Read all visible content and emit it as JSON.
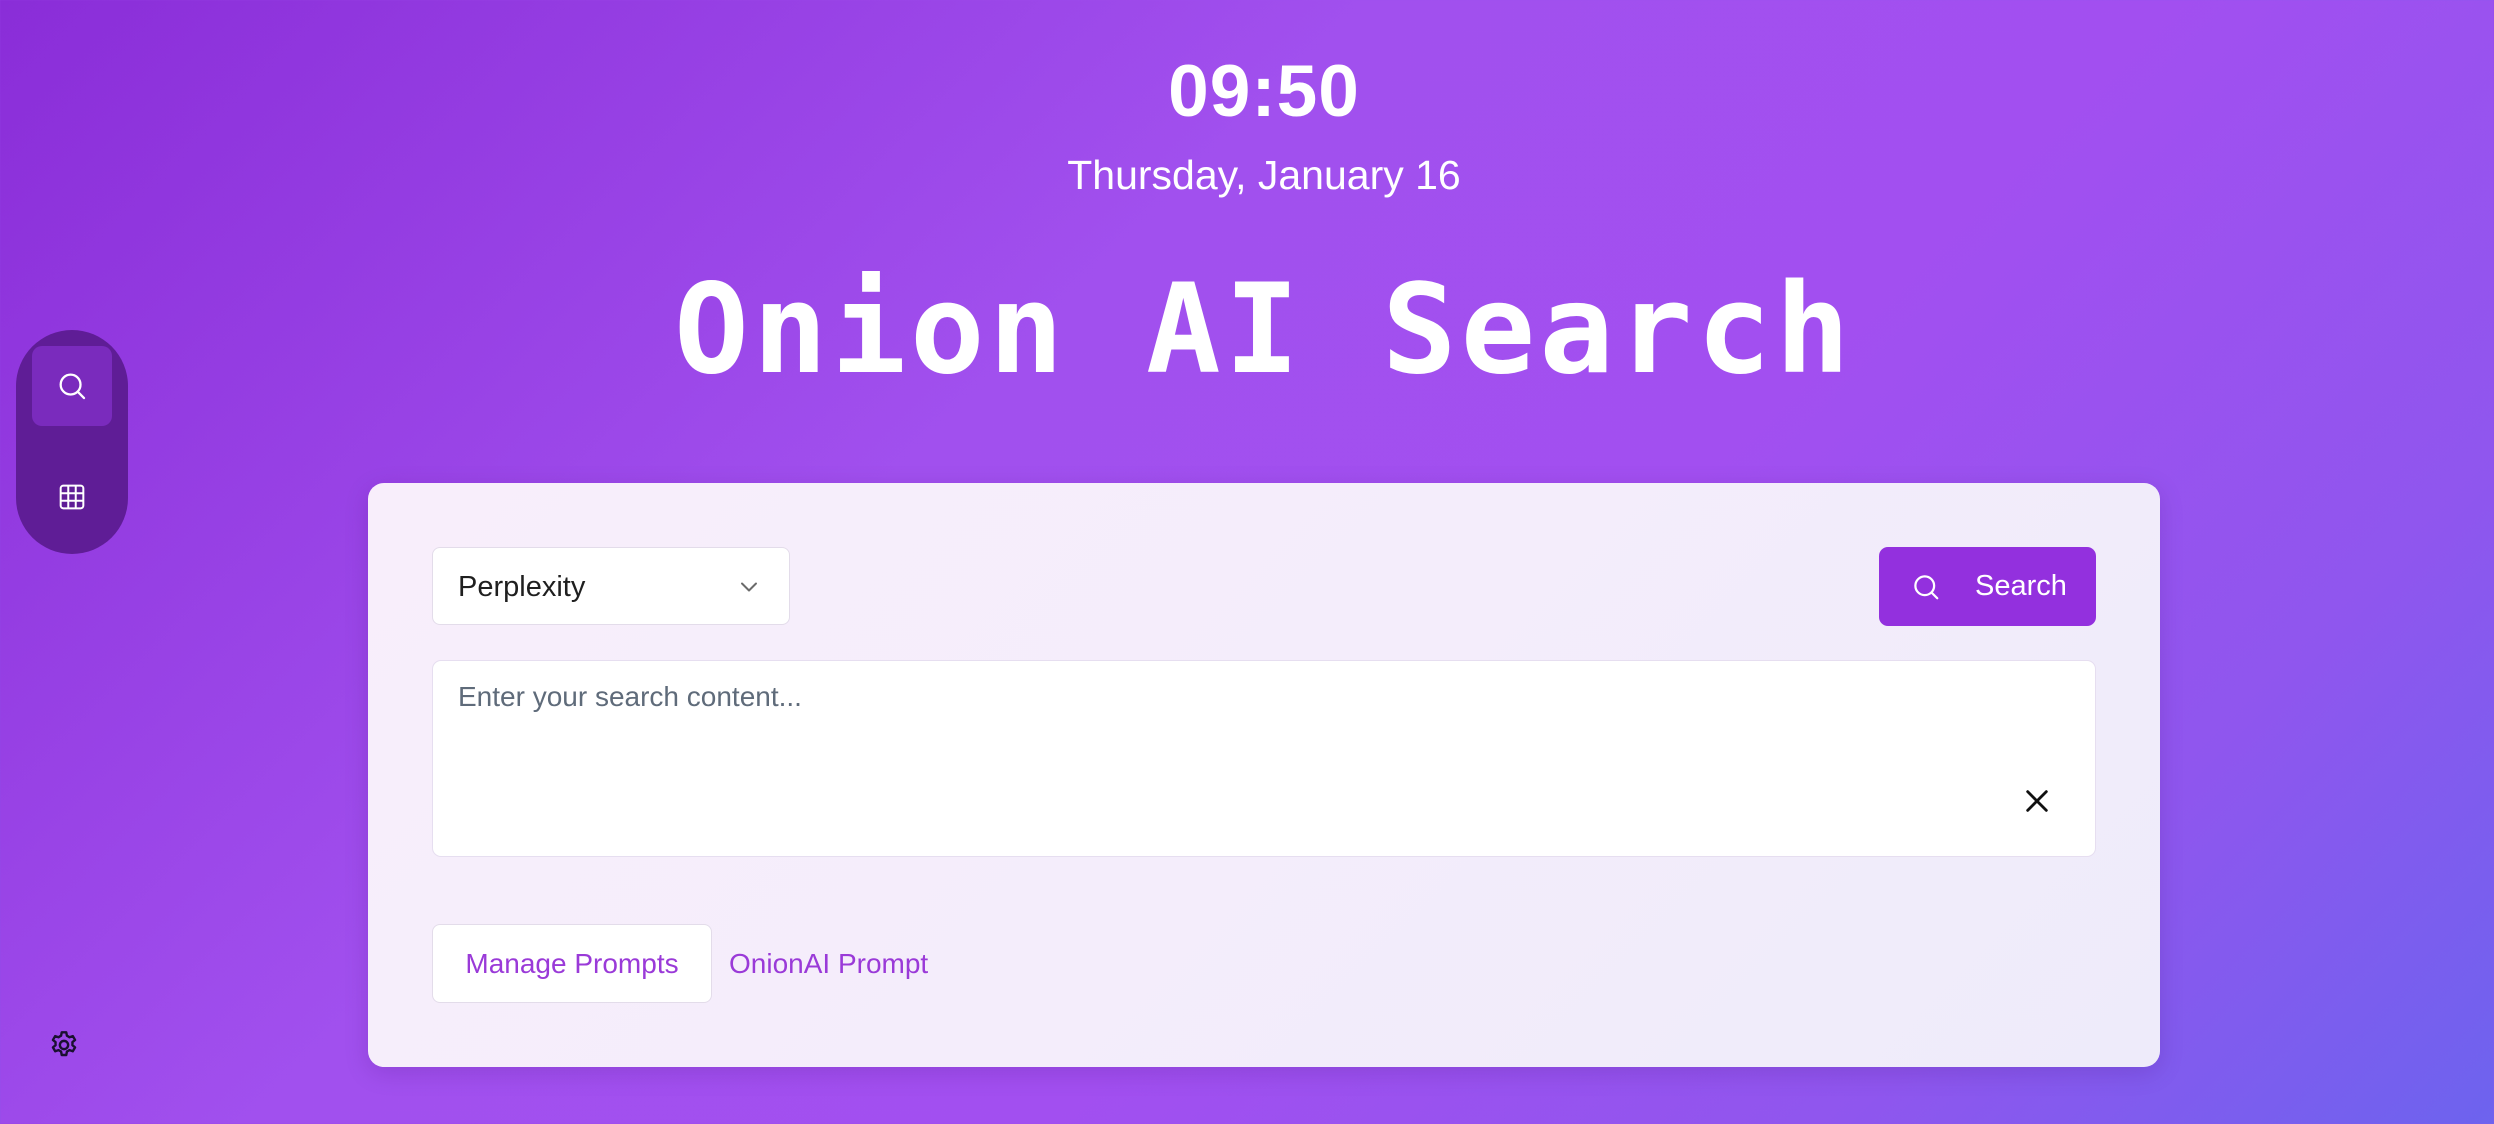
{
  "clock": {
    "time": "09:50",
    "date": "Thursday, January 16"
  },
  "app": {
    "title": "Onion AI Search"
  },
  "sidebar": {
    "items": [
      {
        "icon": "search-icon",
        "active": true
      },
      {
        "icon": "grid-icon",
        "active": false
      }
    ],
    "settings_icon": "gear-icon"
  },
  "search_panel": {
    "engine": {
      "selected": "Perplexity"
    },
    "search_button_label": "Search",
    "query": {
      "placeholder": "Enter your search content...",
      "value": ""
    },
    "prompts": {
      "manage_label": "Manage Prompts",
      "active_prompt": "OnionAI Prompt"
    }
  },
  "colors": {
    "accent": "#9330de",
    "link": "#9a3ad8",
    "background_start": "#8a2dd8",
    "background_end": "#6d63ee"
  }
}
